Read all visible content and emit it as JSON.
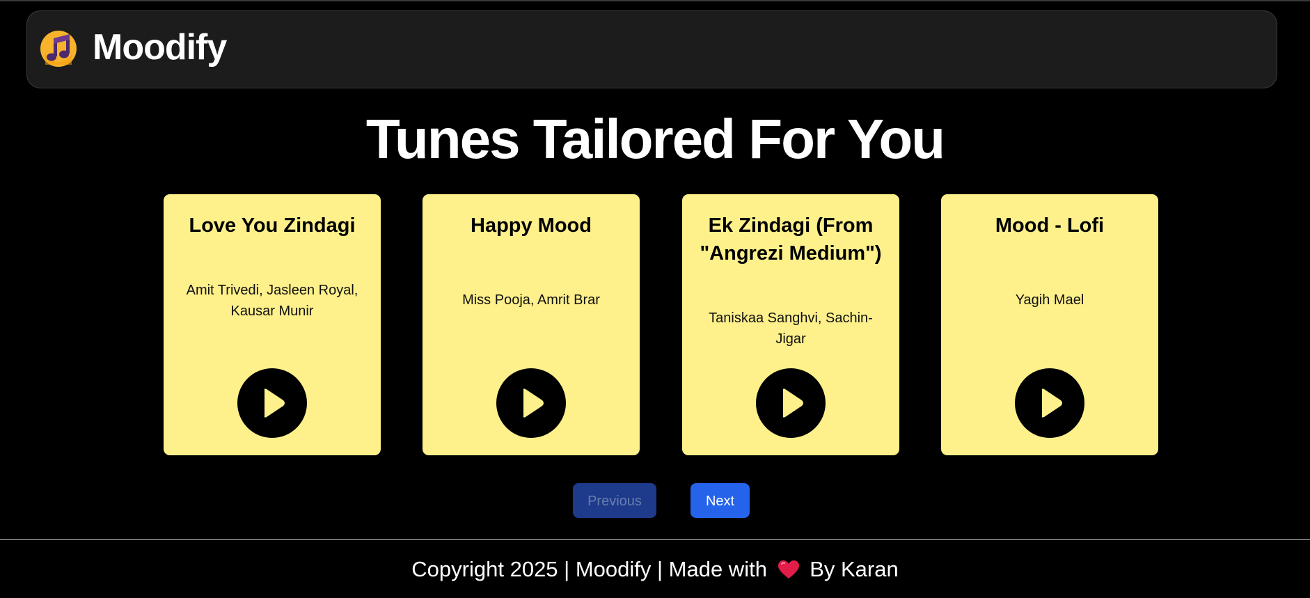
{
  "app": {
    "name": "Moodify",
    "logo_icon": "music-note-logo-icon"
  },
  "main": {
    "heading": "Tunes Tailored For You"
  },
  "cards": [
    {
      "title": "Love You Zindagi",
      "artist": "Amit Trivedi, Jasleen Royal, Kausar Munir",
      "play_icon": "play-icon"
    },
    {
      "title": "Happy Mood",
      "artist": "Miss Pooja, Amrit Brar",
      "play_icon": "play-icon"
    },
    {
      "title": "Ek Zindagi (From \"Angrezi Medium\")",
      "artist": "Taniskaa Sanghvi, Sachin-Jigar",
      "play_icon": "play-icon"
    },
    {
      "title": "Mood - Lofi",
      "artist": "Yagih Mael",
      "play_icon": "play-icon"
    }
  ],
  "pagination": {
    "previous_label": "Previous",
    "next_label": "Next"
  },
  "footer": {
    "text_before": "Copyright 2025 | Moodify | Made with",
    "text_after": "By Karan",
    "heart_icon": "heart-icon"
  },
  "colors": {
    "card_bg": "#fef08a",
    "navbar_bg": "#1c1c1c",
    "next_button": "#2563eb",
    "previous_button": "#1e3a8a",
    "heart": "#e11d48"
  }
}
